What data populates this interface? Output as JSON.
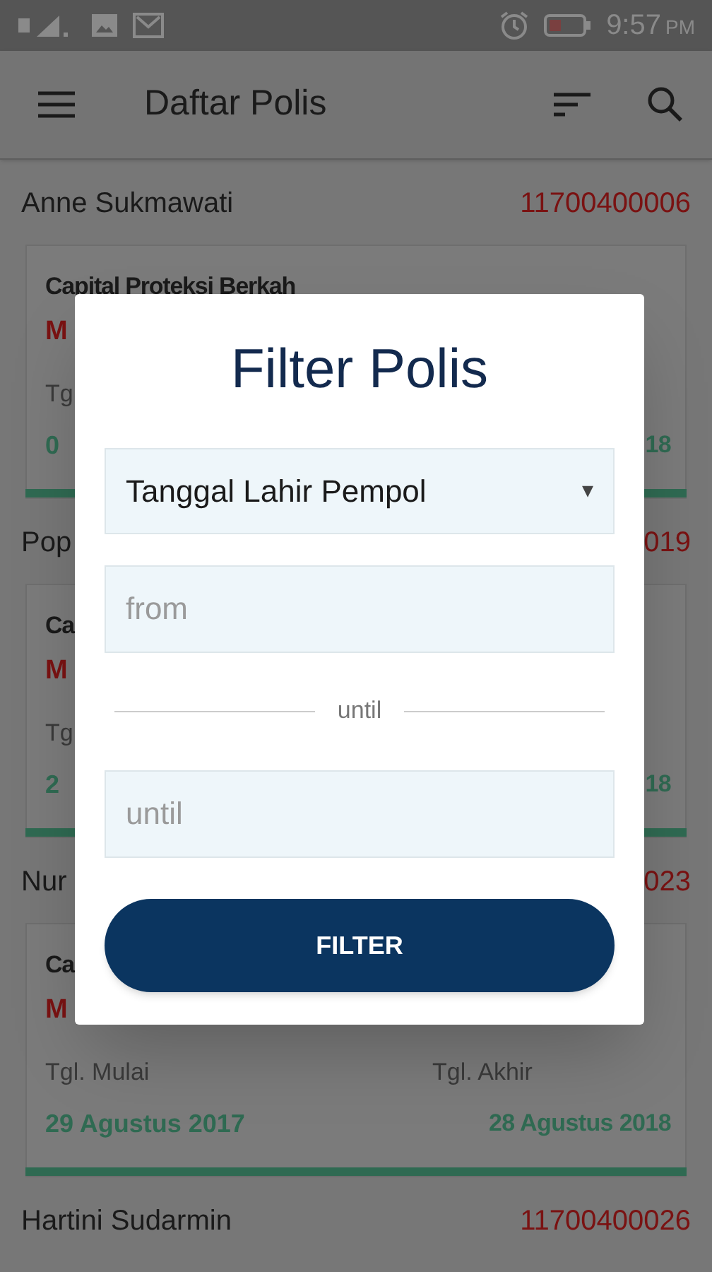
{
  "status_bar": {
    "time": "9:57",
    "time_suffix": "PM"
  },
  "app_bar": {
    "title": "Daftar Polis"
  },
  "policies": [
    {
      "holder": "Anne Sukmawati",
      "number": "11700400006",
      "product": "Capital Proteksi Berkah",
      "status": "M",
      "start_label": "Tg",
      "start_date": "0",
      "end_date": "18"
    },
    {
      "holder": "Pop",
      "number": "019",
      "product": "Ca",
      "status": "M",
      "start_label": "Tg",
      "start_date": "2",
      "end_date": "18"
    },
    {
      "holder": "Nur",
      "number": "023",
      "product": "Ca",
      "status": "M",
      "start_label": "Tgl. Mulai",
      "end_label": "Tgl. Akhir",
      "start_date": "29 Agustus 2017",
      "end_date": "28 Agustus 2018"
    },
    {
      "holder": "Hartini Sudarmin",
      "number": "11700400026"
    }
  ],
  "dialog": {
    "title": "Filter Polis",
    "select": {
      "value": "Tanggal Lahir Pempol",
      "arrow": "▾"
    },
    "from": {
      "placeholder": "from"
    },
    "separator": "until",
    "until": {
      "placeholder": "until"
    },
    "button": "FILTER"
  }
}
